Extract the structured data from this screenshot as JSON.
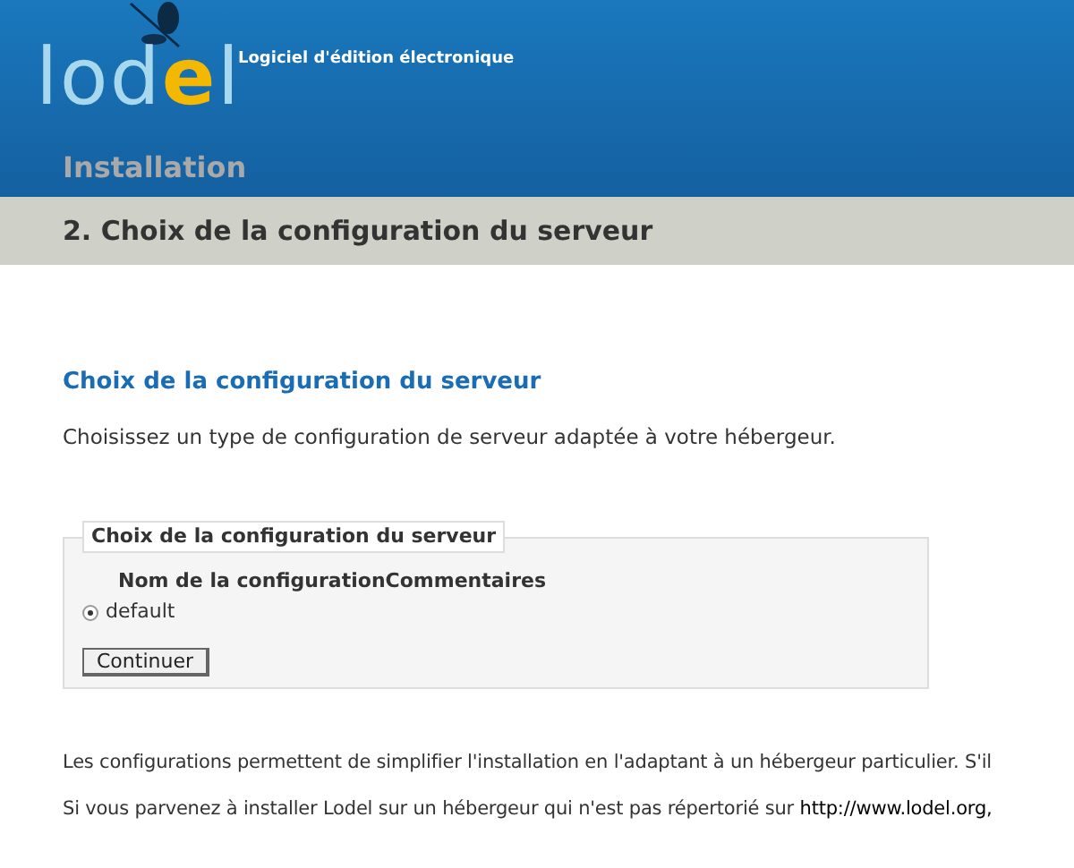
{
  "header": {
    "logo": "lod",
    "logo_accent": "e",
    "logo_end": "l",
    "tagline": "Logiciel d'édition électronique",
    "section": "Installation"
  },
  "step_title": "2. Choix de la configuration du serveur",
  "content": {
    "heading": "Choix de la configuration du serveur",
    "intro": "Choisissez un type de configuration de serveur adaptée à votre hébergeur.",
    "form": {
      "legend": "Choix de la configuration du serveur",
      "columns": [
        "Nom de la configuration",
        "Commentaires"
      ],
      "options": [
        {
          "label": "default",
          "selected": true
        }
      ],
      "button": "Continuer"
    },
    "paragraphs": [
      {
        "text": "Les configurations permettent de simplifier l'installation en l'adaptant à un hébergeur particulier. S'il"
      },
      {
        "text": "Si vous parvenez à installer Lodel sur un hébergeur qui n'est pas répertorié sur",
        "link": "http://www.lodel.org,"
      }
    ]
  }
}
